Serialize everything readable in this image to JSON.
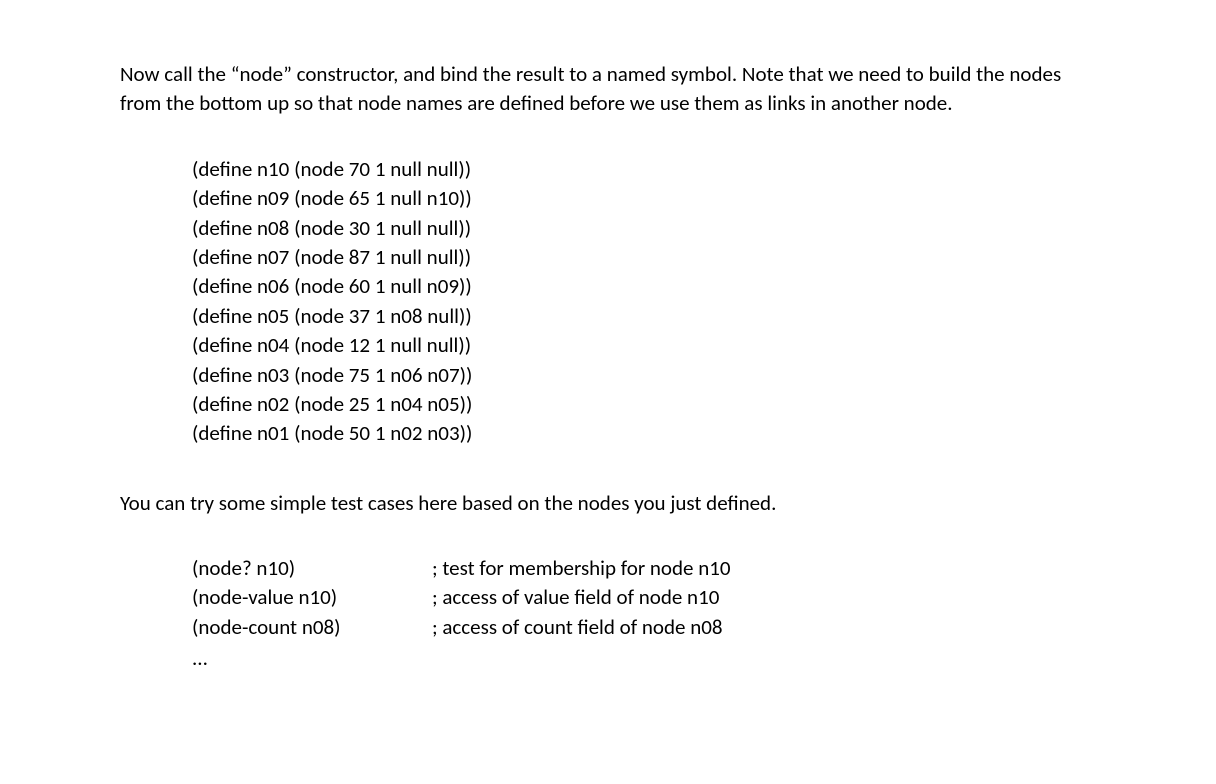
{
  "paragraph1": "Now call the “node” constructor, and bind the result to a named symbol. Note that we need to build the nodes from the bottom up so that node names are defined before we use them as links in another node.",
  "code_lines": [
    "(define n10 (node 70 1 null null))",
    "(define n09 (node 65 1 null n10))",
    "(define n08 (node 30 1 null null))",
    "(define n07 (node 87 1 null null))",
    "(define n06 (node 60 1 null n09))",
    "(define n05 (node 37 1 n08 null))",
    "(define n04 (node 12 1 null null))",
    "(define n03 (node 75 1 n06 n07))",
    "(define n02 (node 25 1 n04 n05))",
    "(define n01 (node 50 1 n02 n03))"
  ],
  "paragraph2": "You can try some simple test cases here based on the nodes you just defined.",
  "test_cases": [
    {
      "call": "(node? n10)",
      "comment": "; test for membership for node n10"
    },
    {
      "call": "(node-value n10)",
      "comment": "; access of value field of node n10"
    },
    {
      "call": "(node-count n08)",
      "comment": "; access of count field of node n08"
    }
  ],
  "ellipsis": "..."
}
